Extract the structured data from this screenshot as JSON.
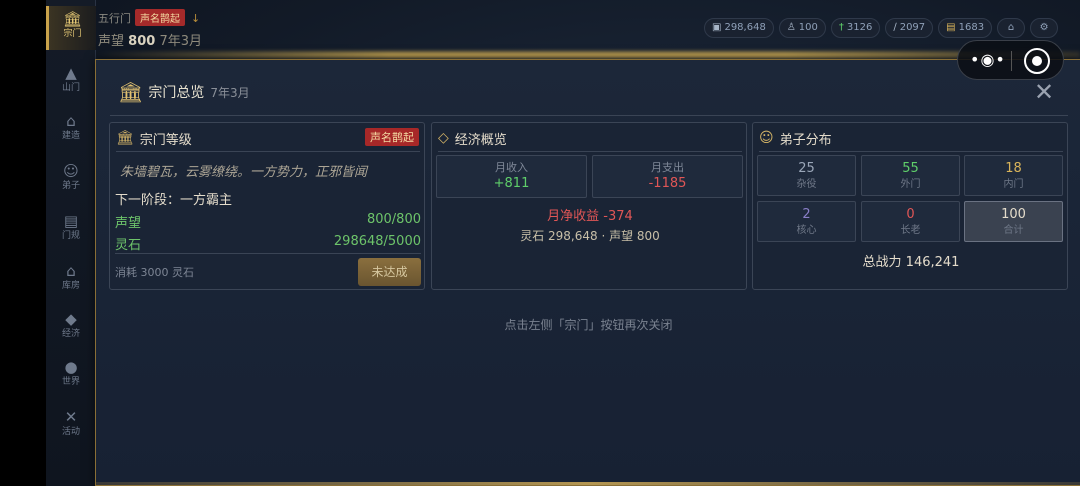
{
  "header": {
    "sect_name": "五行门",
    "sect_badge": "声名鹊起",
    "reputation_label": "声望",
    "reputation_value": "800",
    "date": "7年3月"
  },
  "resources": [
    {
      "icon": "coin-icon",
      "value": "298,648"
    },
    {
      "icon": "person-icon",
      "value": "100"
    },
    {
      "icon": "sword-icon",
      "value": "3126"
    },
    {
      "icon": "brush-icon",
      "value": "2097"
    },
    {
      "icon": "chest-icon",
      "value": "1683"
    }
  ],
  "sidebar": {
    "items": [
      {
        "label": "宗门",
        "icon": "pavilion-icon"
      },
      {
        "label": "山门",
        "icon": "mountain-icon"
      },
      {
        "label": "建造",
        "icon": "building-icon"
      },
      {
        "label": "弟子",
        "icon": "disciple-icon"
      },
      {
        "label": "门规",
        "icon": "rules-icon"
      },
      {
        "label": "库房",
        "icon": "storage-icon"
      },
      {
        "label": "经济",
        "icon": "diamond-icon"
      },
      {
        "label": "世界",
        "icon": "globe-icon"
      },
      {
        "label": "活动",
        "icon": "swords-icon"
      }
    ]
  },
  "modal": {
    "title": "宗门总览",
    "date": "7年3月",
    "footer_hint": "点击左侧「宗门」按钮再次关闭"
  },
  "rank_panel": {
    "title": "宗门等级",
    "badge": "声名鹊起",
    "motto": "朱墙碧瓦，云雾缭绕。一方势力，正邪皆闻",
    "next_stage": "下一阶段：一方霸主",
    "rows": [
      {
        "label": "声望",
        "value": "800/800"
      },
      {
        "label": "灵石",
        "value": "298648/5000"
      }
    ],
    "cost": "消耗 3000 灵石",
    "button": "未达成"
  },
  "economy_panel": {
    "title": "经济概览",
    "income_label": "月收入",
    "income_value": "+811",
    "expense_label": "月支出",
    "expense_value": "-1185",
    "net": "月净收益 -374",
    "summary": "灵石 298,648 · 声望 800"
  },
  "disciple_panel": {
    "title": "弟子分布",
    "cells": [
      {
        "value": "25",
        "label": "杂役",
        "color": "#9aa6b8"
      },
      {
        "value": "55",
        "label": "外门",
        "color": "#5fcf6a"
      },
      {
        "value": "18",
        "label": "内门",
        "color": "#d9b45a"
      },
      {
        "value": "2",
        "label": "核心",
        "color": "#8a7fc8"
      },
      {
        "value": "0",
        "label": "长老",
        "color": "#e05656"
      },
      {
        "value": "100",
        "label": "合计",
        "color": "#e4dccb"
      }
    ],
    "power": "总战力 146,241"
  }
}
